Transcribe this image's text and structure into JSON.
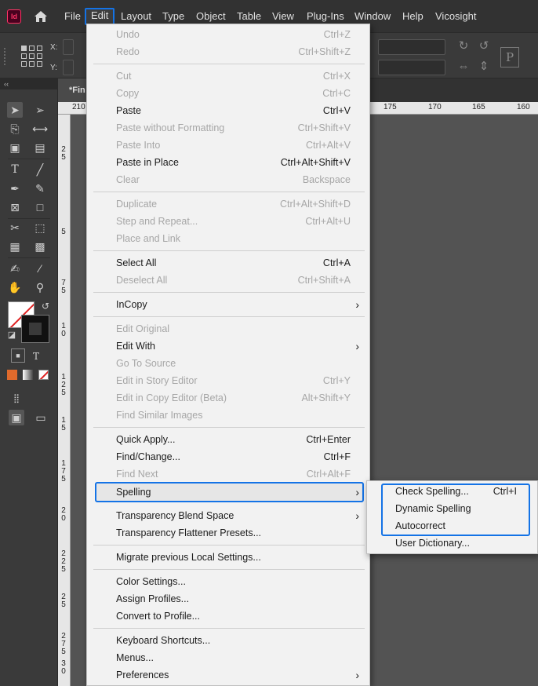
{
  "app": {
    "logo_text": "Id",
    "menu": [
      "File",
      "Edit",
      "Layout",
      "Type",
      "Object",
      "Table",
      "View",
      "Plug-Ins",
      "Window",
      "Help",
      "Vicosight"
    ],
    "active_menu": "Edit"
  },
  "control_bar": {
    "x_label": "X:",
    "y_label": "Y:"
  },
  "document": {
    "tab_title": "*Fin"
  },
  "ruler": {
    "top_labels": [
      "210",
      "175",
      "170",
      "165",
      "160"
    ],
    "left_labels": [
      "2 5",
      "5",
      "7 5",
      "1 0",
      "1 2 5",
      "1 5",
      "1 7 5",
      "2 0",
      "2 2 5",
      "2 5",
      "2 7 5",
      "3 0"
    ]
  },
  "edit_menu": {
    "undo": {
      "label": "Undo",
      "shortcut": "Ctrl+Z"
    },
    "redo": {
      "label": "Redo",
      "shortcut": "Ctrl+Shift+Z"
    },
    "cut": {
      "label": "Cut",
      "shortcut": "Ctrl+X"
    },
    "copy": {
      "label": "Copy",
      "shortcut": "Ctrl+C"
    },
    "paste": {
      "label": "Paste",
      "shortcut": "Ctrl+V"
    },
    "paste_without_formatting": {
      "label": "Paste without Formatting",
      "shortcut": "Ctrl+Shift+V"
    },
    "paste_into": {
      "label": "Paste Into",
      "shortcut": "Ctrl+Alt+V"
    },
    "paste_in_place": {
      "label": "Paste in Place",
      "shortcut": "Ctrl+Alt+Shift+V"
    },
    "clear": {
      "label": "Clear",
      "shortcut": "Backspace"
    },
    "duplicate": {
      "label": "Duplicate",
      "shortcut": "Ctrl+Alt+Shift+D"
    },
    "step_and_repeat": {
      "label": "Step and Repeat...",
      "shortcut": "Ctrl+Alt+U"
    },
    "place_and_link": {
      "label": "Place and Link"
    },
    "select_all": {
      "label": "Select All",
      "shortcut": "Ctrl+A"
    },
    "deselect_all": {
      "label": "Deselect All",
      "shortcut": "Ctrl+Shift+A"
    },
    "incopy": {
      "label": "InCopy"
    },
    "edit_original": {
      "label": "Edit Original"
    },
    "edit_with": {
      "label": "Edit With"
    },
    "go_to_source": {
      "label": "Go To Source"
    },
    "edit_in_story_editor": {
      "label": "Edit in Story Editor",
      "shortcut": "Ctrl+Y"
    },
    "edit_in_copy_editor": {
      "label": "Edit in Copy Editor (Beta)",
      "shortcut": "Alt+Shift+Y"
    },
    "find_similar_images": {
      "label": "Find Similar Images"
    },
    "quick_apply": {
      "label": "Quick Apply...",
      "shortcut": "Ctrl+Enter"
    },
    "find_change": {
      "label": "Find/Change...",
      "shortcut": "Ctrl+F"
    },
    "find_next": {
      "label": "Find Next",
      "shortcut": "Ctrl+Alt+F"
    },
    "spelling": {
      "label": "Spelling"
    },
    "transparency_blend_space": {
      "label": "Transparency Blend Space"
    },
    "transparency_flattener_presets": {
      "label": "Transparency Flattener Presets..."
    },
    "migrate_settings": {
      "label": "Migrate previous Local Settings..."
    },
    "color_settings": {
      "label": "Color Settings..."
    },
    "assign_profiles": {
      "label": "Assign Profiles..."
    },
    "convert_to_profile": {
      "label": "Convert to Profile..."
    },
    "keyboard_shortcuts": {
      "label": "Keyboard Shortcuts..."
    },
    "menus": {
      "label": "Menus..."
    },
    "preferences": {
      "label": "Preferences"
    }
  },
  "spelling_submenu": {
    "check_spelling": {
      "label": "Check Spelling...",
      "shortcut": "Ctrl+I"
    },
    "dynamic_spelling": {
      "label": "Dynamic Spelling"
    },
    "autocorrect": {
      "label": "Autocorrect"
    },
    "user_dictionary": {
      "label": "User Dictionary..."
    }
  },
  "colors": {
    "accent": "#1473e6",
    "menu_bg": "#f2f2f2",
    "app_chrome": "#323232",
    "logo": "#ff3366"
  }
}
